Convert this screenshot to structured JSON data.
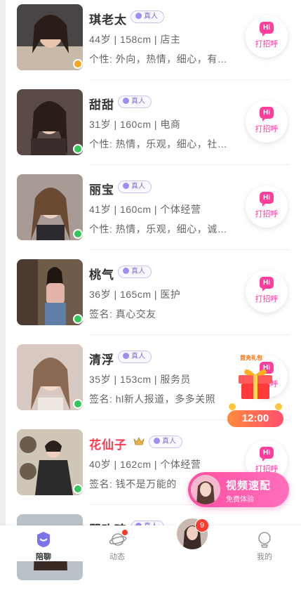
{
  "users": [
    {
      "name": "琪老太",
      "verified": "真人",
      "info": "44岁 | 158cm | 店主",
      "desc": "个性: 外向，热情，细心，有…",
      "online": "away"
    },
    {
      "name": "甜甜",
      "verified": "真人",
      "info": "31岁 | 160cm | 电商",
      "desc": "个性: 热情，乐观，细心，社…",
      "online": "online"
    },
    {
      "name": "丽宝",
      "verified": "真人",
      "info": "41岁 | 160cm | 个体经营",
      "desc": "个性: 热情，乐观，细心，诚…",
      "online": "online"
    },
    {
      "name": "桃气",
      "verified": "真人",
      "info": "36岁 | 165cm | 医护",
      "desc": "签名: 真心交友",
      "online": "online"
    },
    {
      "name": "清浮",
      "verified": "真人",
      "info": "35岁 | 153cm | 服务员",
      "desc": "签名: hl新人报道，多多关照",
      "online": "online"
    },
    {
      "name": "花仙子",
      "verified": "真人",
      "info": "40岁 | 162cm | 个体经营",
      "desc": "签名: 钱不是万能的",
      "online": "online",
      "vip": true
    },
    {
      "name": "罂玫瑰",
      "verified": "真人",
      "info": "",
      "desc": "",
      "online": "online"
    }
  ],
  "greet": {
    "hi": "Hi",
    "label": "打招呼"
  },
  "gift": {
    "label": "首充礼包",
    "timer": "12:00"
  },
  "match": {
    "title": "视频速配",
    "subtitle": "免费体验"
  },
  "tabs": [
    {
      "label": "陪聊"
    },
    {
      "label": "动态"
    },
    {
      "label": "我的"
    }
  ],
  "center_badge": "9",
  "colors": {
    "accent": "#ff3e9b",
    "online": "#34c759",
    "away": "#f5a623"
  }
}
